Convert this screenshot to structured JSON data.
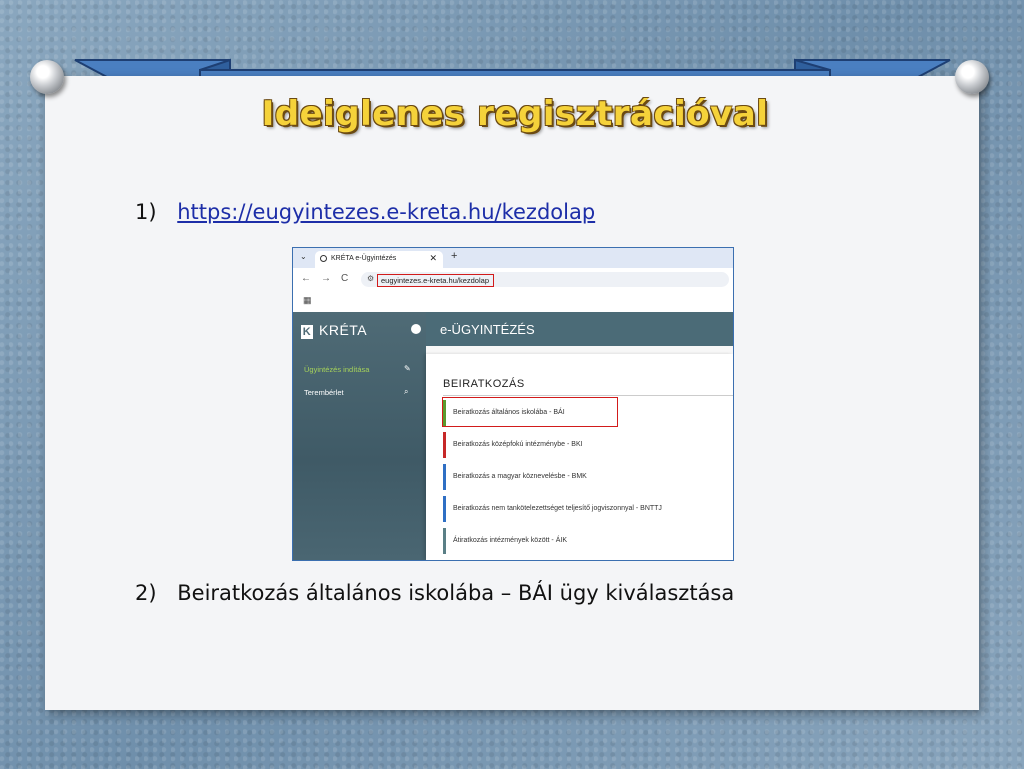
{
  "slide": {
    "title": "Ideiglenes regisztrációval",
    "step1": {
      "number": "1)",
      "link_text": "https://eugyintezes.e-kreta.hu/kezdolap"
    },
    "step2": {
      "number": "2)",
      "text": "Beiratkozás általános iskolába – BÁI ügy kiválasztása"
    },
    "colors": {
      "ribbon": "#4a7fc1",
      "title": "#f5d23a",
      "card": "#f4f5f7",
      "highlight": "#d21b1b"
    }
  },
  "browser": {
    "tab_label": "KRÉTA e-Ügyintézés",
    "tab_close": "✕",
    "new_tab": "+",
    "back": "←",
    "forward": "→",
    "reload": "C",
    "url": "eugyintezes.e-kreta.hu/kezdolap"
  },
  "app": {
    "brand": "KRÉTA",
    "header_title": "e-ÜGYINTÉZÉS",
    "sidebar": [
      {
        "label": "Ügyintézés indítása",
        "icon": "edit-icon",
        "active": true
      },
      {
        "label": "Terembérlet",
        "icon": "search-icon",
        "active": false
      }
    ],
    "section_title": "BEIRATKOZÁS",
    "entries": [
      {
        "label": "Beiratkozás általános iskolába - BÁI",
        "color": "#5a9a2e"
      },
      {
        "label": "Beiratkozás középfokú intézménybe - BKI",
        "color": "#c62828"
      },
      {
        "label": "Beiratkozás a magyar köznevelésbe - BMK",
        "color": "#2f6fc4"
      },
      {
        "label": "Beiratkozás nem tankötelezettséget teljesítő jogviszonnyal - BNTTJ",
        "color": "#2f6fc4"
      },
      {
        "label": "Átiratkozás intézmények között - ÁIK",
        "color": "#5a7f86"
      }
    ]
  }
}
